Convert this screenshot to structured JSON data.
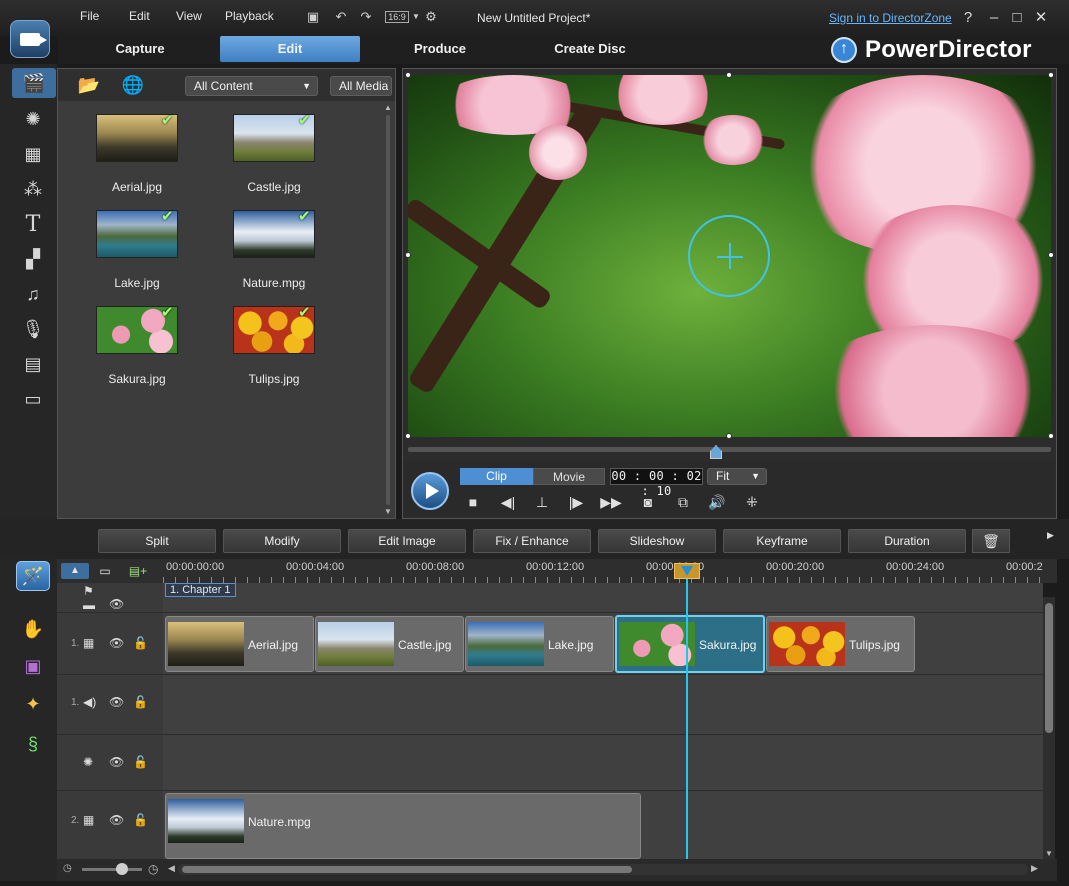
{
  "menu": {
    "items": [
      "File",
      "Edit",
      "View",
      "Playback"
    ],
    "project_title": "New Untitled Project*",
    "signin": "Sign in to DirectorZone",
    "aspect_ratio": "16:9"
  },
  "modes": {
    "tabs": [
      "Capture",
      "Edit",
      "Produce",
      "Create Disc"
    ],
    "active": "Edit"
  },
  "brand": {
    "name": "PowerDirector"
  },
  "library": {
    "filter": "All Content",
    "media_type": "All Media",
    "items": [
      {
        "label": "Aerial.jpg"
      },
      {
        "label": "Castle.jpg"
      },
      {
        "label": "Lake.jpg"
      },
      {
        "label": "Nature.mpg"
      },
      {
        "label": "Sakura.jpg"
      },
      {
        "label": "Tulips.jpg"
      }
    ]
  },
  "preview": {
    "mode_clip": "Clip",
    "mode_movie": "Movie",
    "timecode": "00 : 00 : 02 : 10",
    "zoom": "Fit"
  },
  "actions": {
    "split": "Split",
    "modify": "Modify",
    "edit_image": "Edit Image",
    "fix_enhance": "Fix / Enhance",
    "slideshow": "Slideshow",
    "keyframe": "Keyframe",
    "duration": "Duration"
  },
  "timeline": {
    "ruler": [
      "00:00:00:00",
      "00:00:04:00",
      "00:00:08:00",
      "00:00:12:00",
      "00:00:16:00",
      "00:00:20:00",
      "00:00:24:00",
      "00:00:2"
    ],
    "chapter": "1. Chapter 1",
    "video_track_label": "1.",
    "audio_track_label": "1.",
    "track2_label": "2.",
    "video_clips": [
      {
        "name": "Aerial.jpg"
      },
      {
        "name": "Castle.jpg"
      },
      {
        "name": "Lake.jpg"
      },
      {
        "name": "Sakura.jpg",
        "selected": true
      },
      {
        "name": "Tulips.jpg"
      }
    ],
    "track2_clip": "Nature.mpg"
  },
  "colors": {
    "accent": "#4e8fd3",
    "playhead": "#23c6ee",
    "link": "#66b7ff"
  }
}
